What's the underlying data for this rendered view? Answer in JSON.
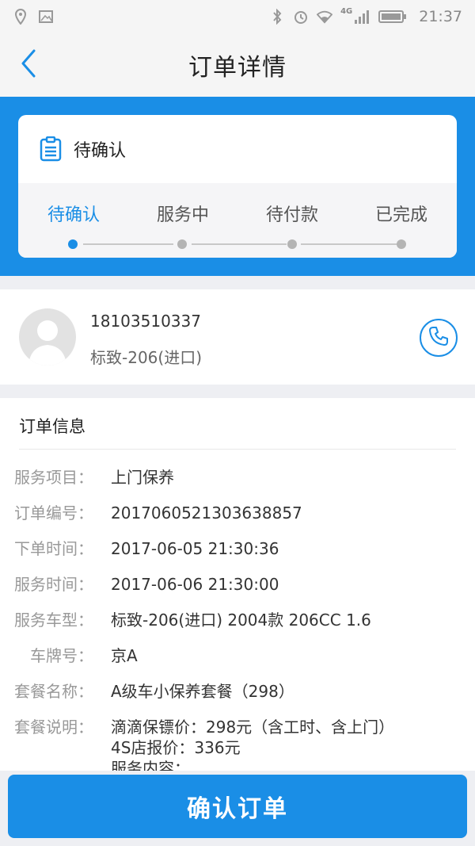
{
  "status_bar": {
    "time": "21:37",
    "network": "4G",
    "icons": [
      "location-icon",
      "image-icon",
      "bluetooth-icon",
      "alarm-icon",
      "wifi-icon",
      "signal-icon",
      "battery-icon"
    ]
  },
  "header": {
    "title": "订单详情",
    "back_icon": "chevron-left-icon"
  },
  "status_card": {
    "current_status": "待确认",
    "steps": [
      "待确认",
      "服务中",
      "待付款",
      "已完成"
    ],
    "active_step_index": 0
  },
  "customer": {
    "phone": "18103510337",
    "car": "标致-206(进口)"
  },
  "order_info": {
    "heading": "订单信息",
    "rows": [
      {
        "label": "服务项目",
        "value": "上门保养"
      },
      {
        "label": "订单编号",
        "value": "2017060521303638857"
      },
      {
        "label": "下单时间",
        "value": "2017-06-05 21:30:36"
      },
      {
        "label": "服务时间",
        "value": "2017-06-06 21:30:00"
      },
      {
        "label": "服务车型",
        "value": "标致-206(进口) 2004款 206CC 1.6"
      },
      {
        "label": "车牌号",
        "value": "京A"
      },
      {
        "label": "套餐名称",
        "value": "A级车小保养套餐（298）"
      },
      {
        "label": "套餐说明",
        "value": "滴滴保镖价：298元（含工时、含上门）",
        "extra_1": "4S店报价：336元",
        "extra_2": "服务内容："
      }
    ]
  },
  "actions": {
    "confirm_label": "确认订单"
  },
  "colors": {
    "accent": "#1a8ee6",
    "background": "#eeeff3"
  }
}
